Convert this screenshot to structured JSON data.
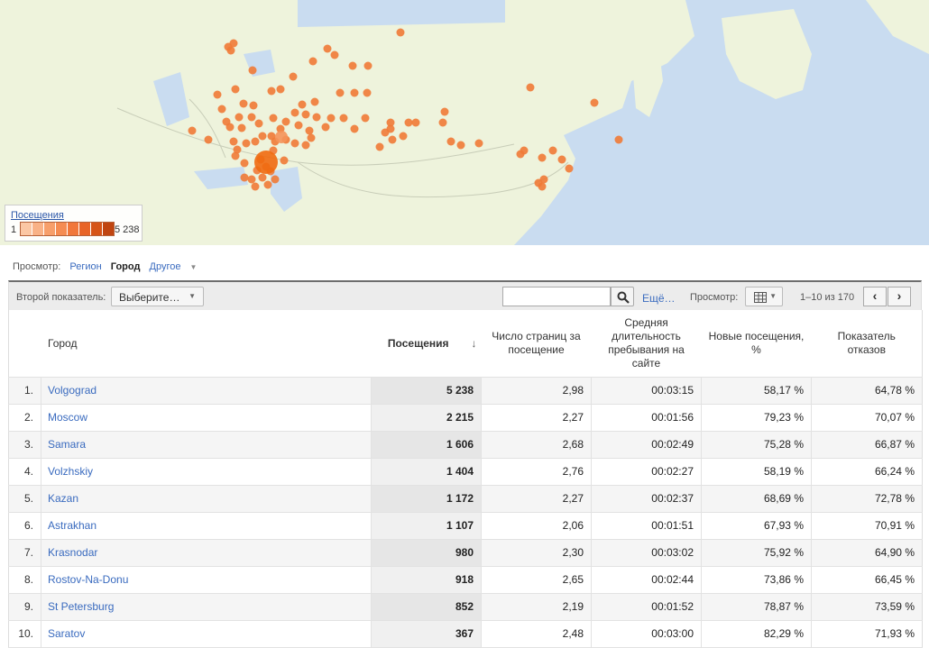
{
  "legend": {
    "title": "Посещения",
    "min": "1",
    "max": "5 238",
    "colors": [
      "#fbc7a4",
      "#f9b287",
      "#f79f6b",
      "#f58c52",
      "#f1773a",
      "#e86426",
      "#d65417",
      "#c04510"
    ]
  },
  "view": {
    "label": "Просмотр:",
    "region": "Регион",
    "city": "Город",
    "other": "Другое"
  },
  "toolbar": {
    "secondary_label": "Второй показатель:",
    "secondary_select": "Выберите…",
    "search_value": "",
    "more": "Ещё…",
    "view_label": "Просмотр:",
    "pager": "1–10 из 170",
    "prev": "‹",
    "next": "›"
  },
  "table": {
    "headers": {
      "city": "Город",
      "visits": "Посещения",
      "sort_arrow": "↓",
      "pages": "Число страниц за посещение",
      "duration": "Средняя длительность пребывания на сайте",
      "new": "Новые посещения, %",
      "bounce": "Показатель отказов"
    },
    "rows": [
      {
        "idx": "1.",
        "city": "Volgograd",
        "visits": "5 238",
        "pages": "2,98",
        "duration": "00:03:15",
        "new": "58,17 %",
        "bounce": "64,78 %"
      },
      {
        "idx": "2.",
        "city": "Moscow",
        "visits": "2 215",
        "pages": "2,27",
        "duration": "00:01:56",
        "new": "79,23 %",
        "bounce": "70,07 %"
      },
      {
        "idx": "3.",
        "city": "Samara",
        "visits": "1 606",
        "pages": "2,68",
        "duration": "00:02:49",
        "new": "75,28 %",
        "bounce": "66,87 %"
      },
      {
        "idx": "4.",
        "city": "Volzhskiy",
        "visits": "1 404",
        "pages": "2,76",
        "duration": "00:02:27",
        "new": "58,19 %",
        "bounce": "66,24 %"
      },
      {
        "idx": "5.",
        "city": "Kazan",
        "visits": "1 172",
        "pages": "2,27",
        "duration": "00:02:37",
        "new": "68,69 %",
        "bounce": "72,78 %"
      },
      {
        "idx": "6.",
        "city": "Astrakhan",
        "visits": "1 107",
        "pages": "2,06",
        "duration": "00:01:51",
        "new": "67,93 %",
        "bounce": "70,91 %"
      },
      {
        "idx": "7.",
        "city": "Krasnodar",
        "visits": "980",
        "pages": "2,30",
        "duration": "00:03:02",
        "new": "75,92 %",
        "bounce": "64,90 %"
      },
      {
        "idx": "8.",
        "city": "Rostov-Na-Donu",
        "visits": "918",
        "pages": "2,65",
        "duration": "00:02:44",
        "new": "73,86 %",
        "bounce": "66,45 %"
      },
      {
        "idx": "9.",
        "city": "St Petersburg",
        "visits": "852",
        "pages": "2,19",
        "duration": "00:01:52",
        "new": "78,87 %",
        "bounce": "73,59 %"
      },
      {
        "idx": "10.",
        "city": "Saratov",
        "visits": "367",
        "pages": "2,48",
        "duration": "00:03:00",
        "new": "82,29 %",
        "bounce": "71,93 %"
      }
    ]
  },
  "colors": {
    "link": "#3a6bbf",
    "marker": "#f07a36",
    "marker_big": "#f06a10",
    "land": "#eef3dc",
    "water": "#c9dcf0"
  }
}
